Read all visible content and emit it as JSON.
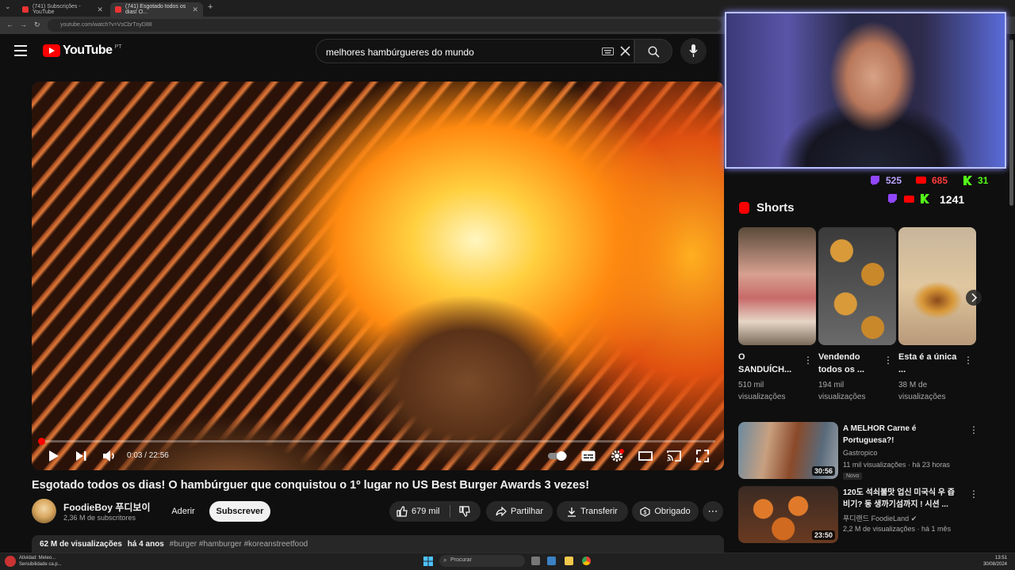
{
  "browser": {
    "tabs": [
      {
        "label": "(741) Subscrições - YouTube"
      },
      {
        "label": "(741) Esgotado todos os dias! O..."
      }
    ],
    "new_tab": "+",
    "address": "youtube.com/watch?v=VsCbrTnyD88"
  },
  "header": {
    "logo": "YouTube",
    "country": "PT",
    "search_value": "melhores hambúrgueres do mundo"
  },
  "player": {
    "time": "0:03 / 22:56",
    "progress": 0.0022,
    "settings_badge": "HD"
  },
  "video": {
    "title": "Esgotado todos os dias! O hambúrguer que conquistou o 1º lugar no US Best Burger Awards 3 vezes!",
    "channel": "FoodieBoy 푸디보이",
    "subscribers": "2,36 M de subscritores",
    "join": "Aderir",
    "subscribe": "Subscrever",
    "likes": "679 mil",
    "share": "Partilhar",
    "download": "Transferir",
    "thanks": "Obrigado",
    "views": "62 M de visualizações",
    "age": "há 4 anos",
    "tags": "#burger #hamburger #koreanstreetfood"
  },
  "stream_stats": {
    "twitch": "525",
    "youtube": "685",
    "kick": "31",
    "total": "1241",
    "colors": {
      "twitch": "#9146ff",
      "youtube": "#ff0000",
      "kick": "#53fc18"
    }
  },
  "shorts": {
    "label": "Shorts",
    "items": [
      {
        "title": "O SANDUÍCH...",
        "views": "510 mil visualizações"
      },
      {
        "title": "Vendendo todos os ...",
        "views": "194 mil visualizações"
      },
      {
        "title": "Esta é a única ...",
        "views": "38 M de visualizações"
      }
    ]
  },
  "recommended": [
    {
      "title": "A MELHOR Carne é Portuguesa?!",
      "channel": "Gastropico",
      "meta": "11 mil visualizações · há 23 horas",
      "badge": "Novo",
      "duration": "30:56"
    },
    {
      "title": "120도 석쇠불맛 업신 미국식 우 즙비기? 동 생까기섬까지 ! 시션 ...",
      "channel": "푸디랜드 FoodieLand",
      "meta": "2,2 M de visualizações · há 1 mês",
      "duration": "23:50"
    }
  ],
  "taskbar": {
    "notification": "Atividad: Meteo... Sensibilidade ca.p...",
    "search_placeholder": "Procurar",
    "clock_time": "13:51",
    "clock_date": "30/08/2024"
  }
}
